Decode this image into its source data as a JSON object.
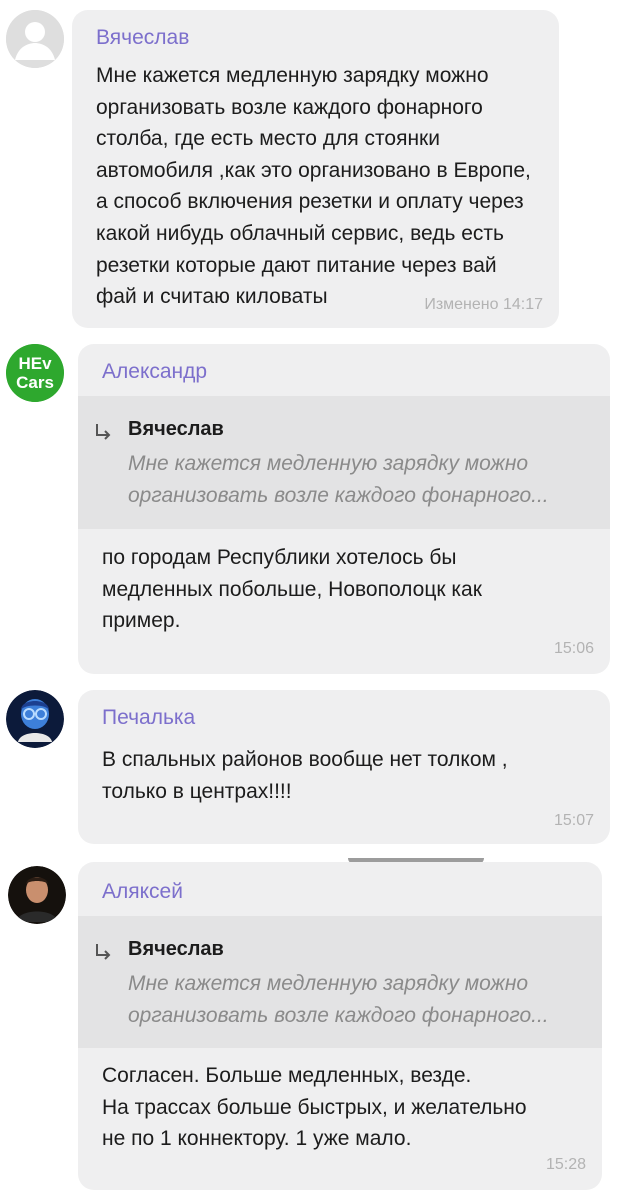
{
  "messages": [
    {
      "author": "Вячеслав",
      "text": "Мне кажется медленную зарядку можно\nорганизовать возле каждого фонарного\nстолба, где есть место для стоянки\nавтомобиля ,как это организовано в Европе,\nа способ включения резетки и оплату через\nкакой нибудь облачный сервис, ведь есть\nрезетки которые дают питание через вай\nфай и считаю киловаты",
      "time": "Изменено 14:17",
      "avatar": "default-user-icon"
    },
    {
      "author": "Александр",
      "avatar": "HEv Cars logo",
      "avatar_lines": [
        "HEv",
        "Cars"
      ],
      "avatar_color": "#2ea82e",
      "reply": {
        "author": "Вячеслав",
        "text": "Мне кажется медленную зарядку можно\nорганизовать возле каждого фонарного..."
      },
      "text": "по городам Республики хотелось бы\nмедленных побольше, Новополоцк как\nпример.",
      "time": "15:06"
    },
    {
      "author": "Печалька",
      "avatar": "blue-character-photo",
      "text": "В спальных районов вообще нет толком ,\nтолько в центрах!!!!",
      "time": "15:07"
    },
    {
      "author": "Аляксей",
      "avatar": "person-photo",
      "reply": {
        "author": "Вячеслав",
        "text": "Мне кажется медленную зарядку можно\nорганизовать возле каждого фонарного..."
      },
      "text": "Согласен. Больше медленных, везде.\nНа трассах больше быстрых, и желательно\nне по 1 коннектору. 1 уже мало.",
      "time": "15:28"
    }
  ],
  "colors": {
    "author_name": "#7c6fcc",
    "bubble": "#efeff0",
    "quote": "#e3e3e4",
    "time": "#b3b3b3"
  }
}
